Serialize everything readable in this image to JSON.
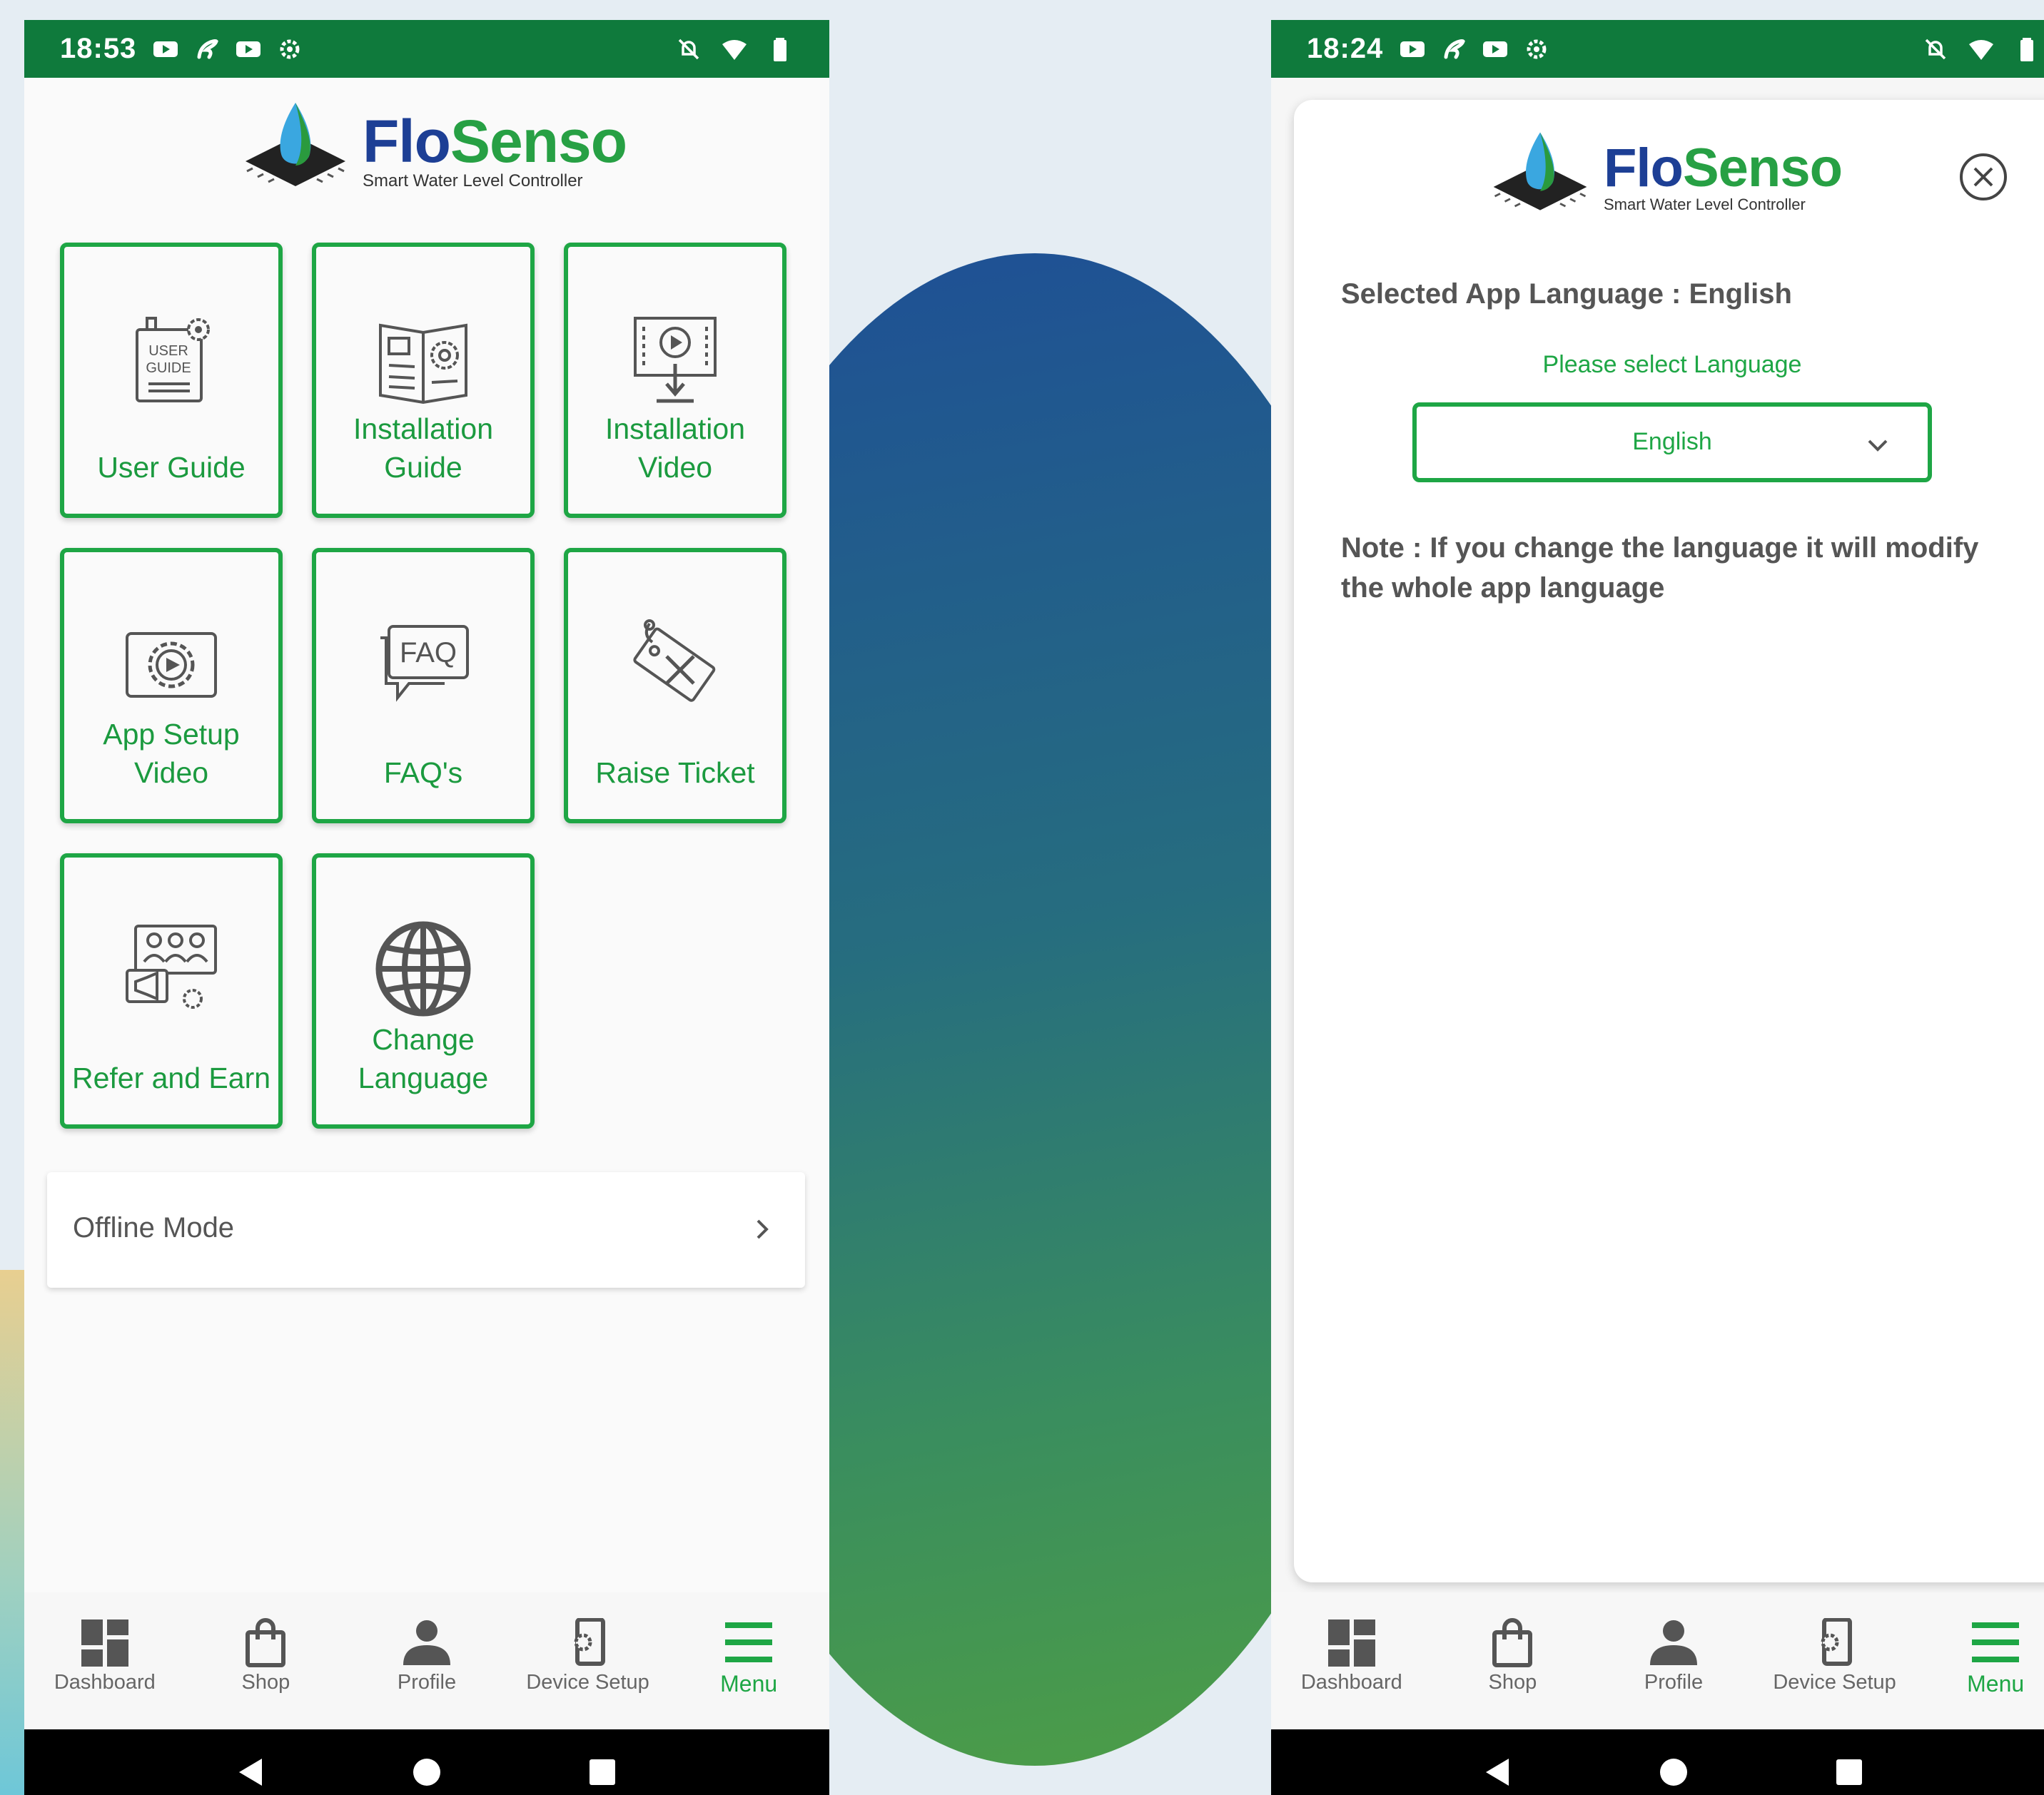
{
  "brand": {
    "name_part1": "Flo",
    "name_part2": "Senso",
    "tagline": "Smart Water Level Controller",
    "colors": {
      "primary_green": "#1ea645",
      "status_green": "#0f7a3c",
      "brand_blue": "#1d3f95"
    }
  },
  "left_screen": {
    "status_time": "18:53",
    "tiles": [
      {
        "label": "User Guide",
        "icon": "user-guide-icon"
      },
      {
        "label": "Installation\nGuide",
        "icon": "installation-guide-icon"
      },
      {
        "label": "Installation\nVideo",
        "icon": "installation-video-icon"
      },
      {
        "label": "App Setup\nVideo",
        "icon": "app-setup-video-icon"
      },
      {
        "label": "FAQ's",
        "icon": "faq-icon"
      },
      {
        "label": "Raise Ticket",
        "icon": "raise-ticket-icon"
      },
      {
        "label": "Refer and Earn",
        "icon": "refer-earn-icon"
      },
      {
        "label": "Change\nLanguage",
        "icon": "globe-icon"
      }
    ],
    "faq_icon_text": "FAQ",
    "user_guide_icon_text": [
      "USER",
      "GUIDE"
    ],
    "offline_mode": "Offline Mode"
  },
  "right_screen": {
    "status_time": "18:24",
    "language_heading": "Selected App Language : English",
    "language_prompt": "Please select Language",
    "language_selected": "English",
    "note": "Note : If you change the language it will modify the whole app language"
  },
  "bottom_nav": [
    {
      "label": "Dashboard",
      "icon": "dashboard-icon"
    },
    {
      "label": "Shop",
      "icon": "shop-bag-icon"
    },
    {
      "label": "Profile",
      "icon": "profile-icon"
    },
    {
      "label": "Device Setup",
      "icon": "device-setup-icon"
    },
    {
      "label": "Menu",
      "icon": "menu-icon",
      "active": true
    }
  ]
}
